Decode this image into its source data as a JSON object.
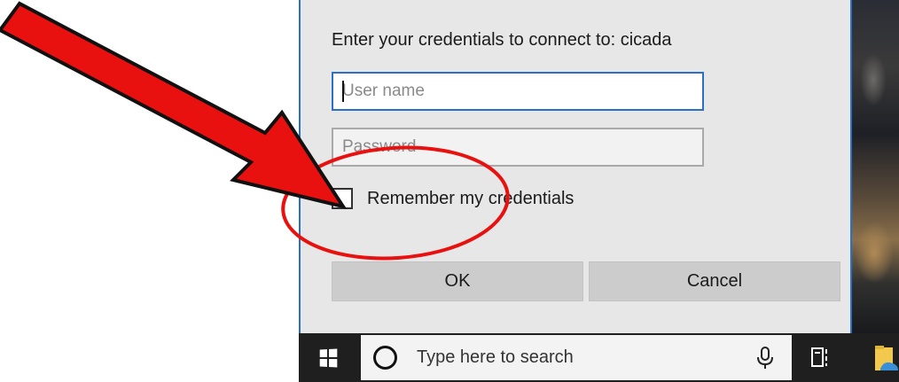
{
  "dialog": {
    "prompt": "Enter your credentials to connect to: cicada",
    "username": {
      "value": "",
      "placeholder": "User name"
    },
    "password": {
      "value": "",
      "placeholder": "Password"
    },
    "remember": {
      "label": "Remember my credentials",
      "checked": false
    },
    "ok_label": "OK",
    "cancel_label": "Cancel",
    "accent_color": "#2a6fc9"
  },
  "taskbar": {
    "start_icon": "windows-logo-icon",
    "search_placeholder": "Type here to search",
    "search_icon": "cortana-circle-icon",
    "mic_icon": "microphone-icon",
    "taskview_icon": "task-view-icon",
    "explorer_icon": "file-explorer-icon"
  },
  "annotations": {
    "arrow_color": "#e8110f",
    "circle_color": "#e8110f"
  }
}
